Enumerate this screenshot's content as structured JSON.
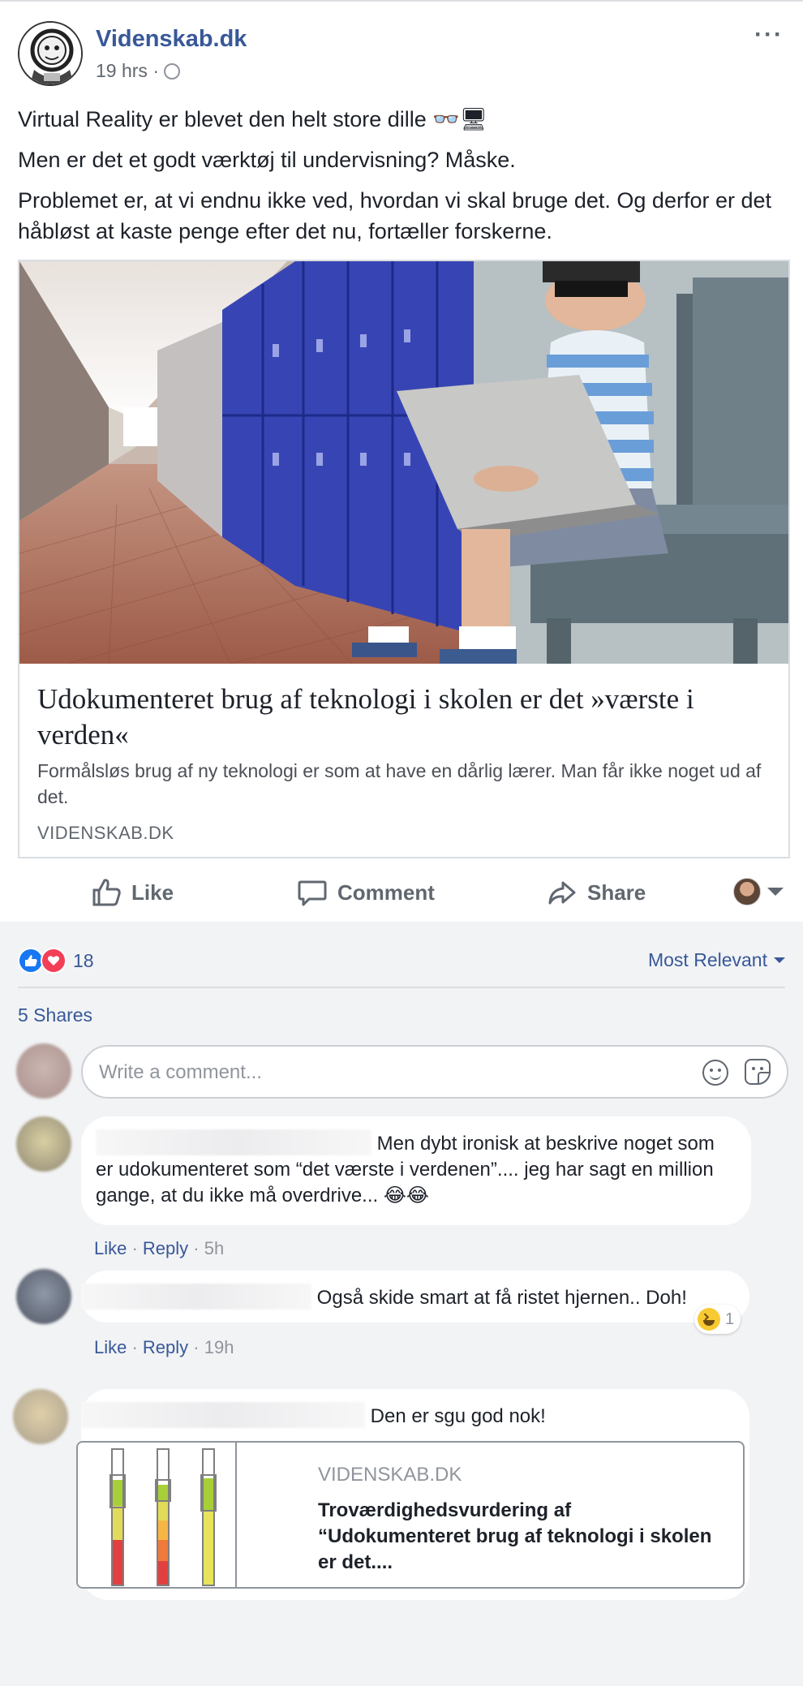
{
  "post": {
    "page_name": "Videnskab.dk",
    "time": "19 hrs",
    "time_separator": "·",
    "more_label": "···",
    "text": {
      "line1": "Virtual Reality er blevet den helt store dille 👓🖥",
      "line2": "Men er det et godt værktøj til undervisning? Måske.",
      "line3": "Problemet er, at vi endnu ikke ved, hvordan vi skal bruge det. Og derfor er det håbløst at kaste penge efter det nu, fortæller forskerne."
    },
    "link": {
      "title": "Udokumenteret brug af teknologi i skolen er det »værste i verden«",
      "description": "Formålsløs brug af ny teknologi er som at have en dårlig lærer. Man får ikke noget ud af det.",
      "domain": "VIDENSKAB.DK"
    },
    "actions": {
      "like": "Like",
      "comment": "Comment",
      "share": "Share"
    }
  },
  "feedback": {
    "reaction_count": "18",
    "sort_label": "Most Relevant",
    "shares": "5 Shares",
    "write_placeholder": "Write a comment..."
  },
  "comments": [
    {
      "text": "Men dybt ironisk at beskrive noget som er udokumenteret som “det værste i verdenen”.... jeg har sagt en million gange, at du ikke må overdrive... 😂😂",
      "like": "Like",
      "reply": "Reply",
      "time": "5h"
    },
    {
      "text": "Også skide smart at få ristet hjernen.. Doh!",
      "like": "Like",
      "reply": "Reply",
      "time": "19h",
      "reaction_count": "1"
    },
    {
      "text": "Den er sgu god nok!",
      "preview": {
        "domain": "VIDENSKAB.DK",
        "title": "Troværdighedsvurdering af “Udokumenteret brug af teknologi i skolen er det...."
      }
    }
  ],
  "colors": {
    "link_blue": "#385898",
    "meta_gray": "#90949c",
    "feedback_bg": "#f2f3f5",
    "like_blue": "#1877f2",
    "love_red": "#f33e58"
  }
}
